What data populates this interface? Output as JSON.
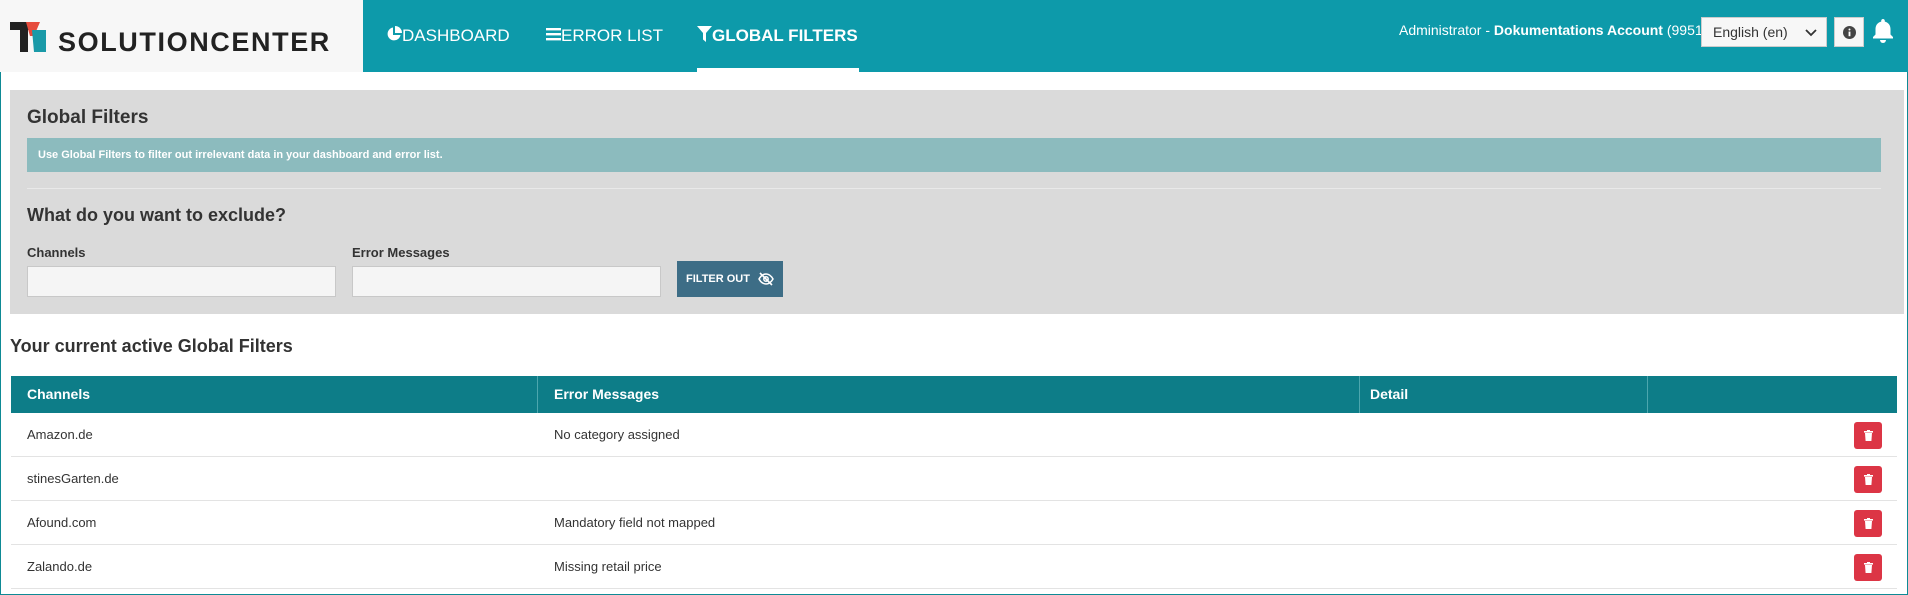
{
  "header": {
    "logo_text": "SOLUTIONCENTER",
    "nav": [
      {
        "label": "DASHBOARD",
        "icon": "pie-chart-icon",
        "active": false
      },
      {
        "label": "ERROR LIST",
        "icon": "list-icon",
        "active": false
      },
      {
        "label": "GLOBAL FILTERS",
        "icon": "filter-icon",
        "active": true
      }
    ],
    "account_user": "Administrator",
    "account_sep": " - ",
    "account_name": "Dokumentations Account",
    "account_id": " (9951)",
    "language": "English (en)",
    "colors": {
      "bar": "#0d9aaa",
      "logo_red": "#e64b3c",
      "logo_teal": "#1a9aa8"
    }
  },
  "panel": {
    "title": "Global Filters",
    "info": "Use Global Filters to filter out irrelevant data in your dashboard and error list.",
    "section_title": "What do you want to exclude?",
    "channels_label": "Channels",
    "channels_value": "",
    "errors_label": "Error Messages",
    "errors_value": "",
    "filter_button": "FILTER OUT"
  },
  "active": {
    "title": "Your current active Global Filters",
    "columns": [
      "Channels",
      "Error Messages",
      "Detail",
      ""
    ],
    "rows": [
      {
        "channel": "Amazon.de",
        "error": "No category assigned",
        "detail": ""
      },
      {
        "channel": "stinesGarten.de",
        "error": "",
        "detail": ""
      },
      {
        "channel": "Afound.com",
        "error": "Mandatory field not mapped",
        "detail": ""
      },
      {
        "channel": "Zalando.de",
        "error": "Missing retail price",
        "detail": ""
      }
    ],
    "colors": {
      "header": "#0d7d88",
      "delete": "#dc3545"
    }
  }
}
